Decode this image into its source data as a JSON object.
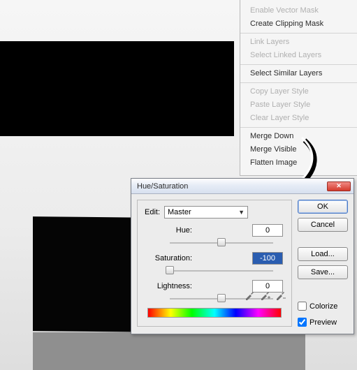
{
  "context_menu": {
    "groups": [
      [
        {
          "label": "Enable Vector Mask",
          "enabled": false
        },
        {
          "label": "Create Clipping Mask",
          "enabled": true
        }
      ],
      [
        {
          "label": "Link Layers",
          "enabled": false
        },
        {
          "label": "Select Linked Layers",
          "enabled": false
        }
      ],
      [
        {
          "label": "Select Similar Layers",
          "enabled": true
        }
      ],
      [
        {
          "label": "Copy Layer Style",
          "enabled": false
        },
        {
          "label": "Paste Layer Style",
          "enabled": false
        },
        {
          "label": "Clear Layer Style",
          "enabled": false
        }
      ],
      [
        {
          "label": "Merge Down",
          "enabled": true
        },
        {
          "label": "Merge Visible",
          "enabled": true
        },
        {
          "label": "Flatten Image",
          "enabled": true
        }
      ]
    ]
  },
  "dialog": {
    "title": "Hue/Saturation",
    "close_glyph": "✕",
    "edit_label": "Edit:",
    "edit_value": "Master",
    "sliders": {
      "hue": {
        "label": "Hue:",
        "value": "0",
        "pos": 50
      },
      "saturation": {
        "label": "Saturation:",
        "value": "-100",
        "pos": 0,
        "selected": true
      },
      "lightness": {
        "label": "Lightness:",
        "value": "0",
        "pos": 50
      }
    },
    "buttons": {
      "ok": "OK",
      "cancel": "Cancel",
      "load": "Load...",
      "save": "Save..."
    },
    "checkboxes": {
      "colorize": {
        "label": "Colorize",
        "checked": false
      },
      "preview": {
        "label": "Preview",
        "checked": true
      }
    }
  }
}
